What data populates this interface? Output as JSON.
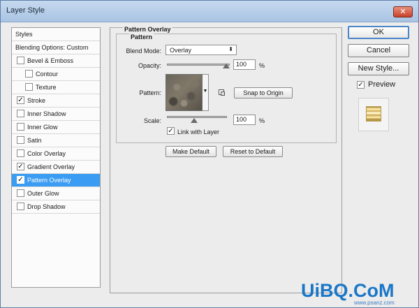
{
  "window": {
    "title": "Layer Style"
  },
  "styles_list": {
    "items": [
      {
        "label": "Styles",
        "checkbox": false,
        "checked": false,
        "indent": 0
      },
      {
        "label": "Blending Options: Custom",
        "checkbox": false,
        "checked": false,
        "indent": 0
      },
      {
        "label": "Bevel & Emboss",
        "checkbox": true,
        "checked": false,
        "indent": 0
      },
      {
        "label": "Contour",
        "checkbox": true,
        "checked": false,
        "indent": 1
      },
      {
        "label": "Texture",
        "checkbox": true,
        "checked": false,
        "indent": 1
      },
      {
        "label": "Stroke",
        "checkbox": true,
        "checked": true,
        "indent": 0
      },
      {
        "label": "Inner Shadow",
        "checkbox": true,
        "checked": false,
        "indent": 0
      },
      {
        "label": "Inner Glow",
        "checkbox": true,
        "checked": false,
        "indent": 0
      },
      {
        "label": "Satin",
        "checkbox": true,
        "checked": false,
        "indent": 0
      },
      {
        "label": "Color Overlay",
        "checkbox": true,
        "checked": false,
        "indent": 0
      },
      {
        "label": "Gradient Overlay",
        "checkbox": true,
        "checked": true,
        "indent": 0
      },
      {
        "label": "Pattern Overlay",
        "checkbox": true,
        "checked": true,
        "indent": 0,
        "selected": true
      },
      {
        "label": "Outer Glow",
        "checkbox": true,
        "checked": false,
        "indent": 0
      },
      {
        "label": "Drop Shadow",
        "checkbox": true,
        "checked": false,
        "indent": 0
      }
    ]
  },
  "pattern_overlay": {
    "section_title": "Pattern Overlay",
    "group_title": "Pattern",
    "blend_mode_label": "Blend Mode:",
    "blend_mode_value": "Overlay",
    "opacity_label": "Opacity:",
    "opacity_value": "100",
    "opacity_level": 1.0,
    "pattern_label": "Pattern:",
    "snap_button": "Snap to Origin",
    "scale_label": "Scale:",
    "scale_value": "100",
    "scale_level": 0.33,
    "percent": "%",
    "link_label": "Link with Layer",
    "link_checked": true,
    "make_default_button": "Make Default",
    "reset_default_button": "Reset to Default"
  },
  "right_panel": {
    "ok": "OK",
    "cancel": "Cancel",
    "new_style": "New Style...",
    "preview_label": "Preview",
    "preview_checked": true
  },
  "watermark": {
    "logo": "UiBQ.CoM",
    "url": "www.psanz.com"
  },
  "colors": {
    "selected": "#3a9cf2",
    "title_bar": "#b6cde9",
    "close": "#c7412a"
  }
}
